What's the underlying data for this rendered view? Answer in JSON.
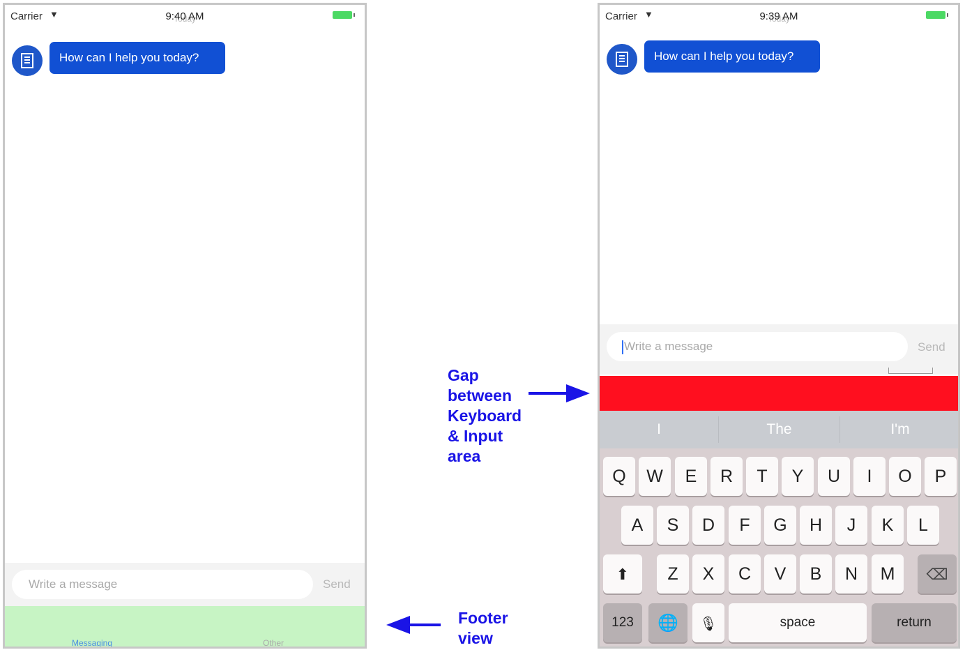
{
  "left_screen": {
    "status": {
      "carrier": "Carrier",
      "time": "9:40 AM",
      "time_ghost": "Today"
    },
    "greeting": "How can I help you today?",
    "input": {
      "placeholder": "Write a message",
      "send_label": "Send"
    },
    "footer": {
      "tab_messaging": "Messaging",
      "tab_other": "Other"
    }
  },
  "right_screen": {
    "status": {
      "carrier": "Carrier",
      "time": "9:39 AM",
      "time_ghost": "Today"
    },
    "greeting": "How can I help you today?",
    "input": {
      "placeholder": "Write a message",
      "send_label": "Send"
    },
    "suggestions": [
      "I",
      "The",
      "I'm"
    ],
    "keyboard": {
      "row1": [
        "Q",
        "W",
        "E",
        "R",
        "T",
        "Y",
        "U",
        "I",
        "O",
        "P"
      ],
      "row2": [
        "A",
        "S",
        "D",
        "F",
        "G",
        "H",
        "J",
        "K",
        "L"
      ],
      "row3": [
        "Z",
        "X",
        "C",
        "V",
        "B",
        "N",
        "M"
      ],
      "numbers_label": "123",
      "space_label": "space",
      "return_label": "return"
    }
  },
  "annotations": {
    "gap_label": [
      "Gap",
      "between",
      "Keyboard",
      "& Input",
      "area"
    ],
    "footer_label": [
      "Footer",
      "view"
    ]
  },
  "colors": {
    "bubble": "#1150d4",
    "gap_bar": "#ff0f1f",
    "footer": "#c7f4c4",
    "annotation": "#1a14e6"
  }
}
